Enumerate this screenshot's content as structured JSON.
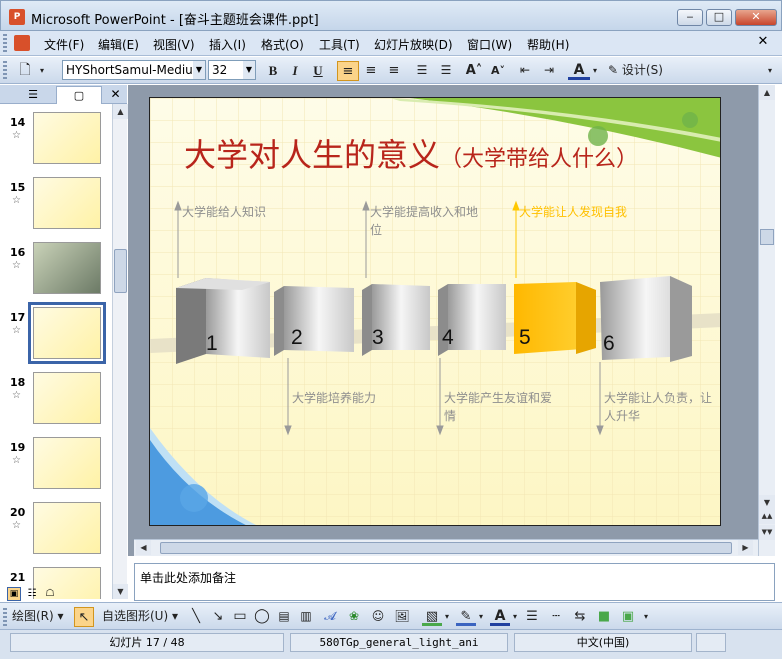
{
  "window": {
    "title": "Microsoft PowerPoint - [奋斗主题班会课件.ppt]",
    "icon": "P"
  },
  "menu": [
    "文件(F)",
    "编辑(E)",
    "视图(V)",
    "插入(I)",
    "格式(O)",
    "工具(T)",
    "幻灯片放映(D)",
    "窗口(W)",
    "帮助(H)"
  ],
  "toolbar": {
    "font": "HYShortSamul-Mediu",
    "size": "32",
    "design_label": "设计(S)"
  },
  "thumbnails": [
    {
      "num": "14",
      "selected": false
    },
    {
      "num": "15",
      "selected": false
    },
    {
      "num": "16",
      "selected": false
    },
    {
      "num": "17",
      "selected": true
    },
    {
      "num": "18",
      "selected": false
    },
    {
      "num": "19",
      "selected": false
    },
    {
      "num": "20",
      "selected": false
    },
    {
      "num": "21",
      "selected": false
    }
  ],
  "slide": {
    "title": "大学对人生的意义",
    "subtitle": "（大学带给人什么）",
    "steps": [
      {
        "num": "1",
        "label": "大学能给人知识",
        "highlight": false
      },
      {
        "num": "2",
        "label": "大学能培养能力",
        "highlight": false
      },
      {
        "num": "3",
        "label": "大学能提高收入和地位",
        "highlight": false
      },
      {
        "num": "4",
        "label": "大学能产生友谊和爱情",
        "highlight": false
      },
      {
        "num": "5",
        "label": "大学能让人发现自我",
        "highlight": true
      },
      {
        "num": "6",
        "label": "大学能让人负责，让人升华",
        "highlight": false
      }
    ]
  },
  "notes": {
    "placeholder": "单击此处添加备注"
  },
  "drawbar": {
    "draw_label": "绘图(R)",
    "autoshape_label": "自选图形(U)"
  },
  "status": {
    "slide": "幻灯片 17 / 48",
    "template": "580TGp_general_light_ani",
    "language": "中文(中国)"
  },
  "colors": {
    "title_red": "#b8251b",
    "highlight_yellow": "#ffc800",
    "label_gray": "#8e8e8e",
    "green_accent": "#8bc53f"
  }
}
